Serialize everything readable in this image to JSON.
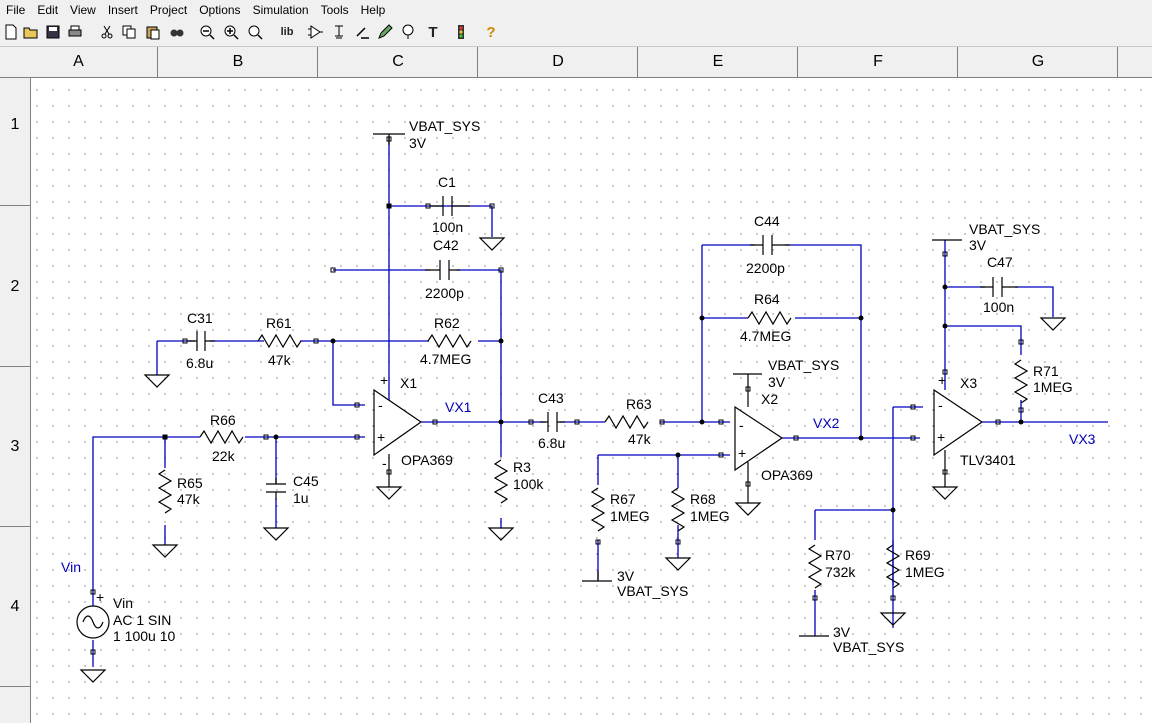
{
  "menu": [
    "File",
    "Edit",
    "View",
    "Insert",
    "Project",
    "Options",
    "Simulation",
    "Tools",
    "Help"
  ],
  "toolbar": {
    "icons": [
      "new-icon",
      "open-icon",
      "save-icon",
      "print-icon",
      "cut-icon",
      "copy-icon",
      "paste-icon",
      "find-icon",
      "zoom-out-icon",
      "zoom-in-icon",
      "zoom-fit-icon",
      "library-icon",
      "component-icon",
      "ground-icon",
      "wire-icon",
      "pencil-icon",
      "probe-icon",
      "text-icon",
      "traffic-light-icon",
      "help-icon"
    ],
    "lib_label": "lib",
    "text_label": "T",
    "help_label": "?"
  },
  "columns": [
    "A",
    "B",
    "C",
    "D",
    "E",
    "F",
    "G"
  ],
  "rows": [
    "1",
    "2",
    "3",
    "4"
  ],
  "colors": {
    "wire": "#0000c0",
    "net_label": "#0000c0",
    "component": "#000000",
    "grid_dot": "#b8b8b8"
  },
  "schematic": {
    "supply_1": {
      "name": "VBAT_SYS",
      "value": "3V"
    },
    "supply_2": {
      "name": "VBAT_SYS",
      "value": "3V"
    },
    "supply_3": {
      "name": "VBAT_SYS",
      "value": "3V"
    },
    "supply_4": {
      "name": "VBAT_SYS",
      "value": "3V"
    },
    "supply_5": {
      "name": "VBAT_SYS",
      "value": "3V"
    },
    "C1": {
      "name": "C1",
      "value": "100n"
    },
    "C42": {
      "name": "C42",
      "value": "2200p"
    },
    "C31": {
      "name": "C31",
      "value": "6.8u"
    },
    "R61": {
      "name": "R61",
      "value": "47k"
    },
    "R62": {
      "name": "R62",
      "value": "4.7MEG"
    },
    "X1": {
      "name": "X1",
      "model": "OPA369"
    },
    "R66": {
      "name": "R66",
      "value": "22k"
    },
    "R65": {
      "name": "R65",
      "value": "47k"
    },
    "C45": {
      "name": "C45",
      "value": "1u"
    },
    "R3": {
      "name": "R3",
      "value": "100k"
    },
    "C43": {
      "name": "C43",
      "value": "6.8u"
    },
    "R63": {
      "name": "R63",
      "value": "47k"
    },
    "C44": {
      "name": "C44",
      "value": "2200p"
    },
    "R64": {
      "name": "R64",
      "value": "4.7MEG"
    },
    "X2": {
      "name": "X2",
      "model": "OPA369"
    },
    "R67": {
      "name": "R67",
      "value": "1MEG"
    },
    "R68": {
      "name": "R68",
      "value": "1MEG"
    },
    "C47": {
      "name": "C47",
      "value": "100n"
    },
    "R71": {
      "name": "R71",
      "value": "1MEG"
    },
    "X3": {
      "name": "X3",
      "model": "TLV3401"
    },
    "R70": {
      "name": "R70",
      "value": "732k"
    },
    "R69": {
      "name": "R69",
      "value": "1MEG"
    },
    "Vin": {
      "name": "Vin",
      "line1": "AC 1   SIN",
      "line2": "1 100u 10"
    },
    "net_labels": {
      "vin": "Vin",
      "vx1": "VX1",
      "vx2": "VX2",
      "vx3": "VX3"
    },
    "pin_minus": "-",
    "pin_plus": "+"
  }
}
